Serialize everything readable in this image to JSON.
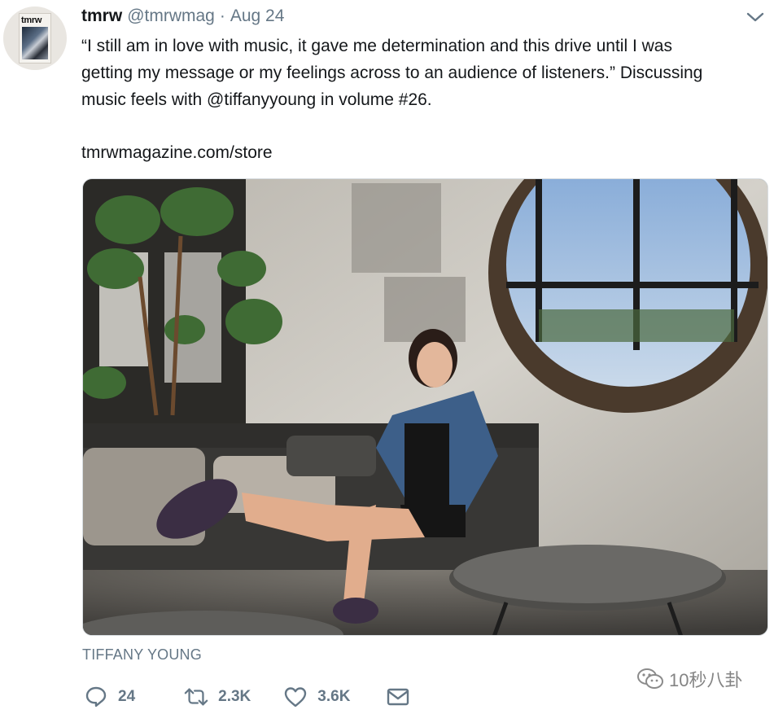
{
  "tweet": {
    "author_name": "tmrw",
    "author_handle": "@tmrwmag",
    "separator": "·",
    "date": "Aug 24",
    "avatar_logo": "tmrw",
    "text": "“I still am in love with music, it gave me determination and this drive until I was\ngetting my message or my feelings across to an audience of listeners.” Discussing\nmusic feels with @tiffanyyoung in volume #26.",
    "link": "tmrwmagazine.com/store",
    "photo_credit": "TIFFANY YOUNG",
    "photo_alt": "Photo of a woman in a denim jacket sitting on a sofa beside a round mirror"
  },
  "actions": {
    "reply": {
      "icon": "reply-icon",
      "count": "24"
    },
    "retweet": {
      "icon": "retweet-icon",
      "count": "2.3K"
    },
    "like": {
      "icon": "heart-icon",
      "count": "3.6K"
    },
    "dm": {
      "icon": "envelope-icon"
    }
  },
  "watermark": {
    "text": "10秒八卦",
    "icon": "wechat-icon"
  },
  "colors": {
    "text": "#14171a",
    "secondary": "#657786",
    "border": "#d8dde1"
  }
}
